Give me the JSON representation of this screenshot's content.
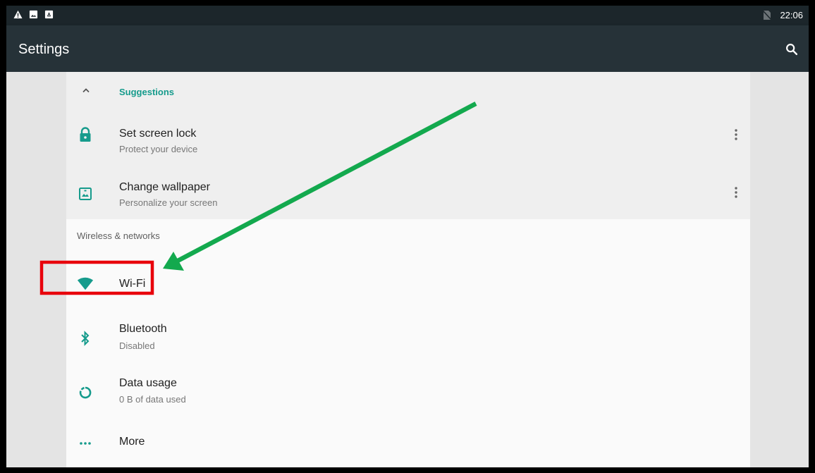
{
  "status_bar": {
    "time": "22:06",
    "left_icons": [
      "warning-icon",
      "image-icon",
      "android-icon"
    ],
    "right_icons": [
      "no-sim-icon"
    ]
  },
  "app_bar": {
    "title": "Settings",
    "action_icon": "search-icon"
  },
  "suggestions": {
    "header_label": "Suggestions",
    "items": [
      {
        "title": "Set screen lock",
        "subtitle": "Protect your device",
        "icon": "lock-icon"
      },
      {
        "title": "Change wallpaper",
        "subtitle": "Personalize your screen",
        "icon": "wallpaper-icon"
      }
    ]
  },
  "wireless_section": {
    "title": "Wireless & networks",
    "items": [
      {
        "title": "Wi-Fi",
        "subtitle": "",
        "icon": "wifi-icon"
      },
      {
        "title": "Bluetooth",
        "subtitle": "Disabled",
        "icon": "bluetooth-icon"
      },
      {
        "title": "Data usage",
        "subtitle": "0 B of data used",
        "icon": "data-usage-icon"
      },
      {
        "title": "More",
        "subtitle": "",
        "icon": "more-horiz-icon"
      }
    ]
  },
  "colors": {
    "accent": "#169b8c",
    "app_bar": "#263238",
    "status_bar": "#1c262b",
    "highlight_box": "#e8000b",
    "arrow": "#13a94e"
  }
}
